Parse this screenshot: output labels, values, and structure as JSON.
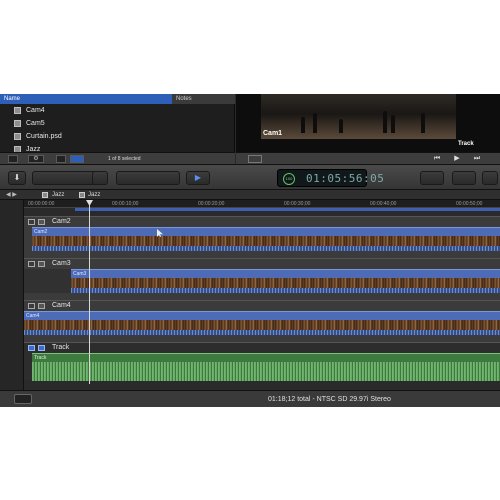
{
  "browser": {
    "columns": {
      "name": "Name",
      "notes": "Notes"
    },
    "items": [
      {
        "label": "Cam4"
      },
      {
        "label": "Cam5"
      },
      {
        "label": "Curtain.psd"
      },
      {
        "label": "Jazz"
      }
    ],
    "selection_count": "1 of 8 selected"
  },
  "viewer": {
    "clip_label": "Cam1",
    "track_label": "Track",
    "controls": {
      "prev": "⏮",
      "play": "▶",
      "next": "⏭"
    }
  },
  "toolbar": {
    "import_icon": "⬇",
    "key_icon": "🔑",
    "select_icon": "▶",
    "timecode": "01:05:56:05",
    "zoom_percent": "100"
  },
  "timeline": {
    "nav": {
      "back": "◀  ▶",
      "crumb1": "Jazz",
      "crumb2": "Jazz"
    },
    "ruler": [
      "00:00:00:00",
      "00:00:10;00",
      "00:00:20;00",
      "00:00:30;00",
      "00:00:40;00",
      "00:00:50;00"
    ],
    "angles": [
      {
        "name": "Cam2",
        "clip": "Cam2"
      },
      {
        "name": "Cam3",
        "clip": "Cam3"
      },
      {
        "name": "Cam4",
        "clip": "Cam4"
      }
    ],
    "audio": {
      "name": "Track",
      "clip": "Track"
    }
  },
  "status": {
    "text": "01:18;12 total - NTSC SD 29.97i Stereo"
  },
  "colors": {
    "accent_blue": "#2e5fb8",
    "video_clip": "#4d6bb7",
    "audio_clip": "#3d7a3d"
  }
}
